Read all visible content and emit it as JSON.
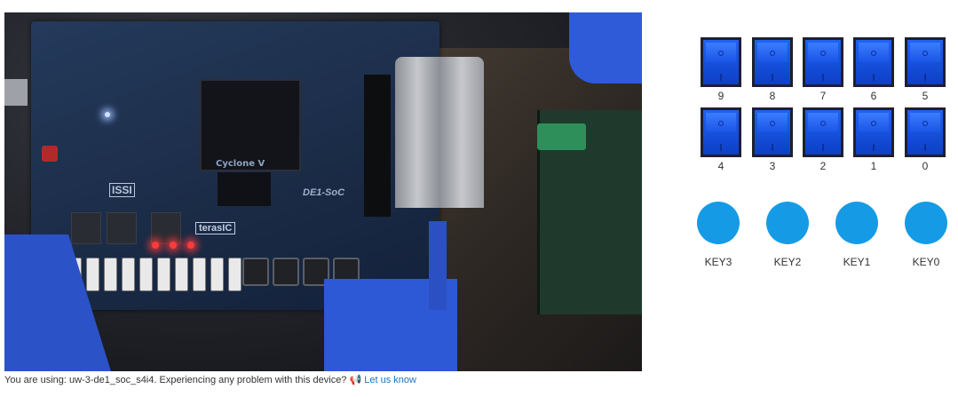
{
  "feed": {
    "chip_label": "Cyclone V",
    "issi_label": "ISSI",
    "brand_label": "terasIC",
    "model_label": "DE1-SoC"
  },
  "switches": [
    {
      "label": "9"
    },
    {
      "label": "8"
    },
    {
      "label": "7"
    },
    {
      "label": "6"
    },
    {
      "label": "5"
    },
    {
      "label": "4"
    },
    {
      "label": "3"
    },
    {
      "label": "2"
    },
    {
      "label": "1"
    },
    {
      "label": "0"
    }
  ],
  "keys": [
    {
      "label": "KEY3"
    },
    {
      "label": "KEY2"
    },
    {
      "label": "KEY1"
    },
    {
      "label": "KEY0"
    }
  ],
  "status": {
    "prefix": "You are using: uw-3-de1_soc_s4i4. Experiencing any problem with this device?",
    "link": "Let us know"
  },
  "colors": {
    "switch_blue": "#1e63f2",
    "key_blue": "#159be6",
    "link_blue": "#1a73c8"
  }
}
